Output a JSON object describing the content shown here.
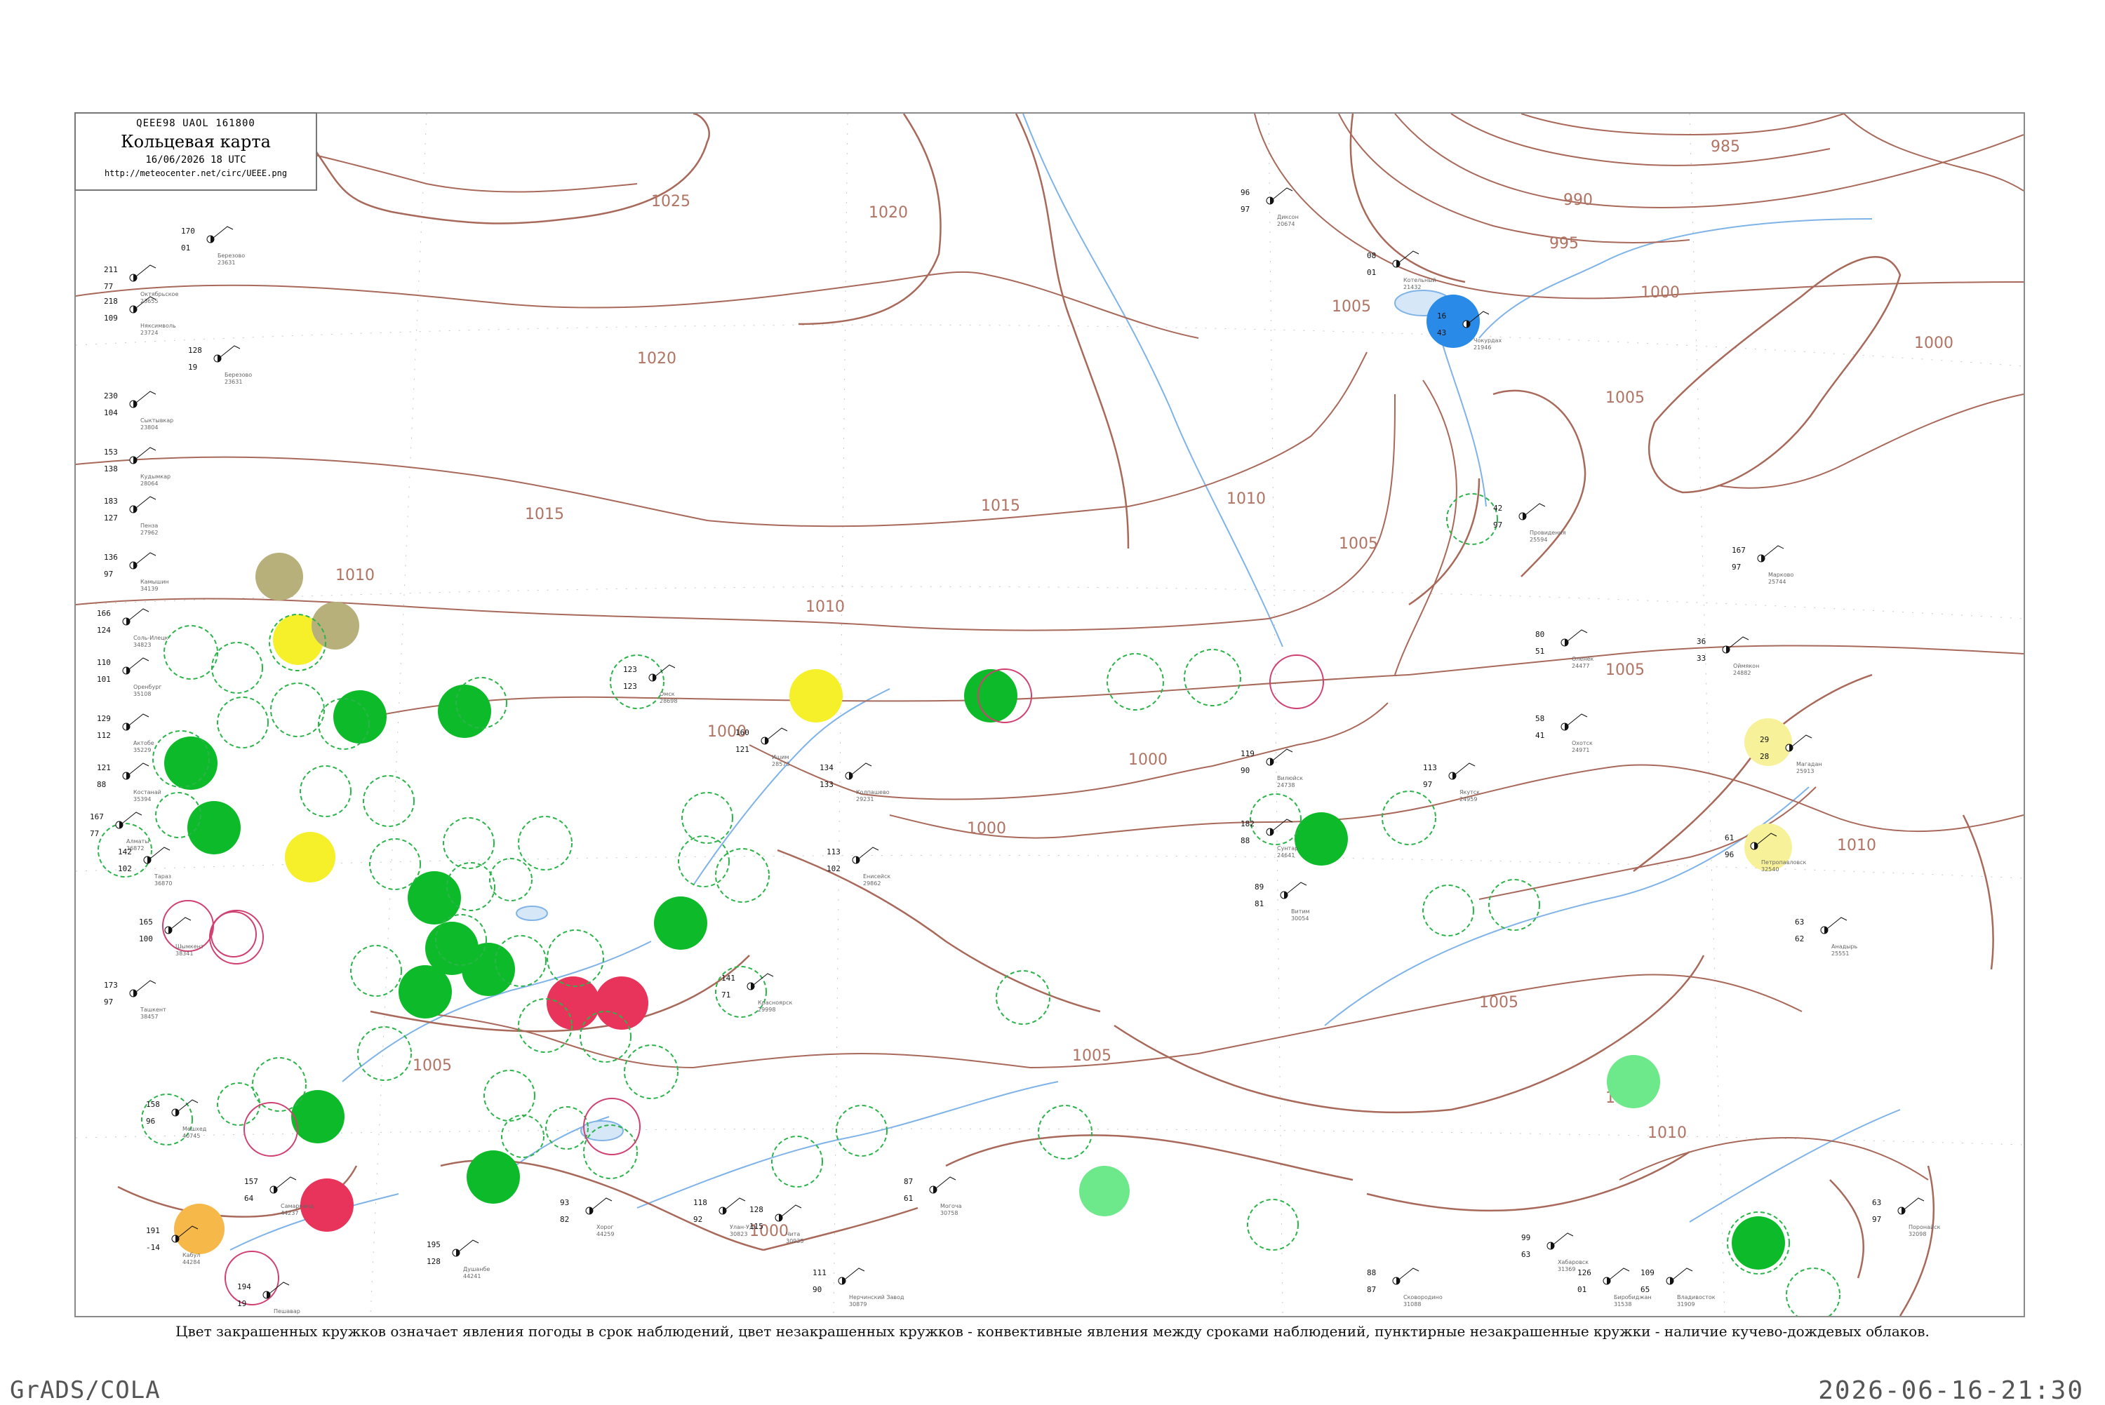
{
  "header": {
    "code": "QEEE98  UAOL  161800",
    "title": "Кольцевая карта",
    "date": "16/06/2026 18 UTC",
    "url": "http://meteocenter.net/circ/UEEE.png"
  },
  "legend_text": "Цвет закрашенных кружков означает явления погоды в срок наблюдений, цвет незакрашенных кружков - конвективные явления между сроками наблюдений, пунктирные незакрашенные кружки - наличие кучево-дождевых облаков.",
  "footer": {
    "left": "GrADS/COLA",
    "right": "2026-06-16-21:30"
  },
  "colors": {
    "isobar": "#a8695a",
    "water": "#7fb3e8",
    "green": "#0dbb2a",
    "light_green": "#6de88a",
    "red": "#e8335a",
    "yellow": "#f5f02a",
    "pale_yellow": "#f7f29a",
    "orange": "#f7b84a",
    "olive": "#b8b07a",
    "blue": "#2a8ae8",
    "cb_dashed": "#2cb34a",
    "conv_ring": "#d04070"
  },
  "isobar_labels": [
    {
      "text": "1025"
    },
    {
      "text": "1020"
    },
    {
      "text": "1020"
    },
    {
      "text": "1015"
    },
    {
      "text": "1015"
    },
    {
      "text": "1010"
    },
    {
      "text": "1010"
    },
    {
      "text": "1010"
    },
    {
      "text": "1005"
    },
    {
      "text": "1005"
    },
    {
      "text": "1005"
    },
    {
      "text": "1000"
    },
    {
      "text": "1000"
    },
    {
      "text": "1000"
    },
    {
      "text": "1000"
    },
    {
      "text": "995"
    },
    {
      "text": "990"
    },
    {
      "text": "985"
    },
    {
      "text": "1005"
    },
    {
      "text": "1000"
    },
    {
      "text": "1010"
    },
    {
      "text": "1010"
    },
    {
      "text": "1005"
    },
    {
      "text": "1005"
    },
    {
      "text": "1010"
    },
    {
      "text": "1005"
    },
    {
      "text": "1000"
    }
  ],
  "stations": [
    {
      "t": "170",
      "d": "01",
      "id": "23631",
      "name": "Березово"
    },
    {
      "t": "211",
      "d": "77",
      "id": "23655",
      "name": "Октябрьское"
    },
    {
      "t": "218",
      "d": "109",
      "id": "23724",
      "name": "Няксимволь"
    },
    {
      "t": "128",
      "d": "19",
      "id": "23631",
      "name": "Березово"
    },
    {
      "t": "230",
      "d": "104",
      "id": "23804",
      "name": "Сыктывкар"
    },
    {
      "t": "153",
      "d": "138",
      "id": "28064",
      "name": "Кудымкар"
    },
    {
      "t": "183",
      "d": "127",
      "id": "27962",
      "name": "Пенза"
    },
    {
      "t": "136",
      "d": "97",
      "id": "34139",
      "name": "Камышин"
    },
    {
      "t": "166",
      "d": "124",
      "id": "34823",
      "name": "Соль-Илецк"
    },
    {
      "t": "110",
      "d": "101",
      "id": "35108",
      "name": "Оренбург"
    },
    {
      "t": "129",
      "d": "112",
      "id": "35229",
      "name": "Актобе"
    },
    {
      "t": "121",
      "d": "88",
      "id": "35394",
      "name": "Костанай"
    },
    {
      "t": "167",
      "d": "77",
      "id": "36872",
      "name": "Алматы"
    },
    {
      "t": "142",
      "d": "102",
      "id": "36870",
      "name": "Тараз"
    },
    {
      "t": "165",
      "d": "100",
      "id": "38341",
      "name": "Шымкент"
    },
    {
      "t": "173",
      "d": "97",
      "id": "38457",
      "name": "Ташкент"
    },
    {
      "t": "158",
      "d": "96",
      "id": "40745",
      "name": "Мешхед"
    },
    {
      "t": "191",
      "d": "-14",
      "id": "44284",
      "name": "Кабул"
    },
    {
      "t": "194",
      "d": "19",
      "id": "44292",
      "name": "Пешавар"
    },
    {
      "t": "157",
      "d": "64",
      "id": "44237",
      "name": "Самарканд"
    },
    {
      "t": "195",
      "d": "128",
      "id": "44241",
      "name": "Душанбе"
    },
    {
      "t": "93",
      "d": "82",
      "id": "44259",
      "name": "Хорог"
    },
    {
      "t": "118",
      "d": "92",
      "id": "30823",
      "name": "Улан-Удэ"
    },
    {
      "t": "128",
      "d": "115",
      "id": "30935",
      "name": "Чита"
    },
    {
      "t": "87",
      "d": "61",
      "id": "30758",
      "name": "Могоча"
    },
    {
      "t": "111",
      "d": "90",
      "id": "30879",
      "name": "Нерчинский Завод"
    },
    {
      "t": "88",
      "d": "87",
      "id": "31088",
      "name": "Сковородино"
    },
    {
      "t": "99",
      "d": "63",
      "id": "31369",
      "name": "Хабаровск"
    },
    {
      "t": "126",
      "d": "01",
      "id": "31538",
      "name": "Биробиджан"
    },
    {
      "t": "109",
      "d": "65",
      "id": "31909",
      "name": "Владивосток"
    },
    {
      "t": "63",
      "d": "97",
      "id": "32098",
      "name": "Поронайск"
    },
    {
      "t": "61",
      "d": "96",
      "id": "32540",
      "name": "Петропавловск"
    },
    {
      "t": "63",
      "d": "62",
      "id": "25551",
      "name": "Анадырь"
    },
    {
      "t": "29",
      "d": "28",
      "id": "25913",
      "name": "Магадан"
    },
    {
      "t": "167",
      "d": "97",
      "id": "25744",
      "name": "Марково"
    },
    {
      "t": "96",
      "d": "97",
      "id": "20674",
      "name": "Диксон"
    },
    {
      "t": "08",
      "d": "01",
      "id": "21432",
      "name": "Котельный"
    },
    {
      "t": "16",
      "d": "43",
      "id": "21946",
      "name": "Чокурдах"
    },
    {
      "t": "42",
      "d": "97",
      "id": "25594",
      "name": "Провидения"
    },
    {
      "t": "80",
      "d": "51",
      "id": "24477",
      "name": "Оленёк"
    },
    {
      "t": "36",
      "d": "33",
      "id": "24882",
      "name": "Оймякон"
    },
    {
      "t": "58",
      "d": "41",
      "id": "24971",
      "name": "Охотск"
    },
    {
      "t": "113",
      "d": "97",
      "id": "24959",
      "name": "Якутск"
    },
    {
      "t": "119",
      "d": "90",
      "id": "24738",
      "name": "Вилюйск"
    },
    {
      "t": "182",
      "d": "88",
      "id": "24641",
      "name": "Сунтар"
    },
    {
      "t": "89",
      "d": "81",
      "id": "30054",
      "name": "Витим"
    },
    {
      "t": "141",
      "d": "71",
      "id": "29998",
      "name": "Красноярск"
    },
    {
      "t": "113",
      "d": "102",
      "id": "29862",
      "name": "Енисейск"
    },
    {
      "t": "134",
      "d": "133",
      "id": "29231",
      "name": "Колпашево"
    },
    {
      "t": "123",
      "d": "123",
      "id": "28698",
      "name": "Омск"
    },
    {
      "t": "160",
      "d": "121",
      "id": "28573",
      "name": "Ишим"
    }
  ]
}
